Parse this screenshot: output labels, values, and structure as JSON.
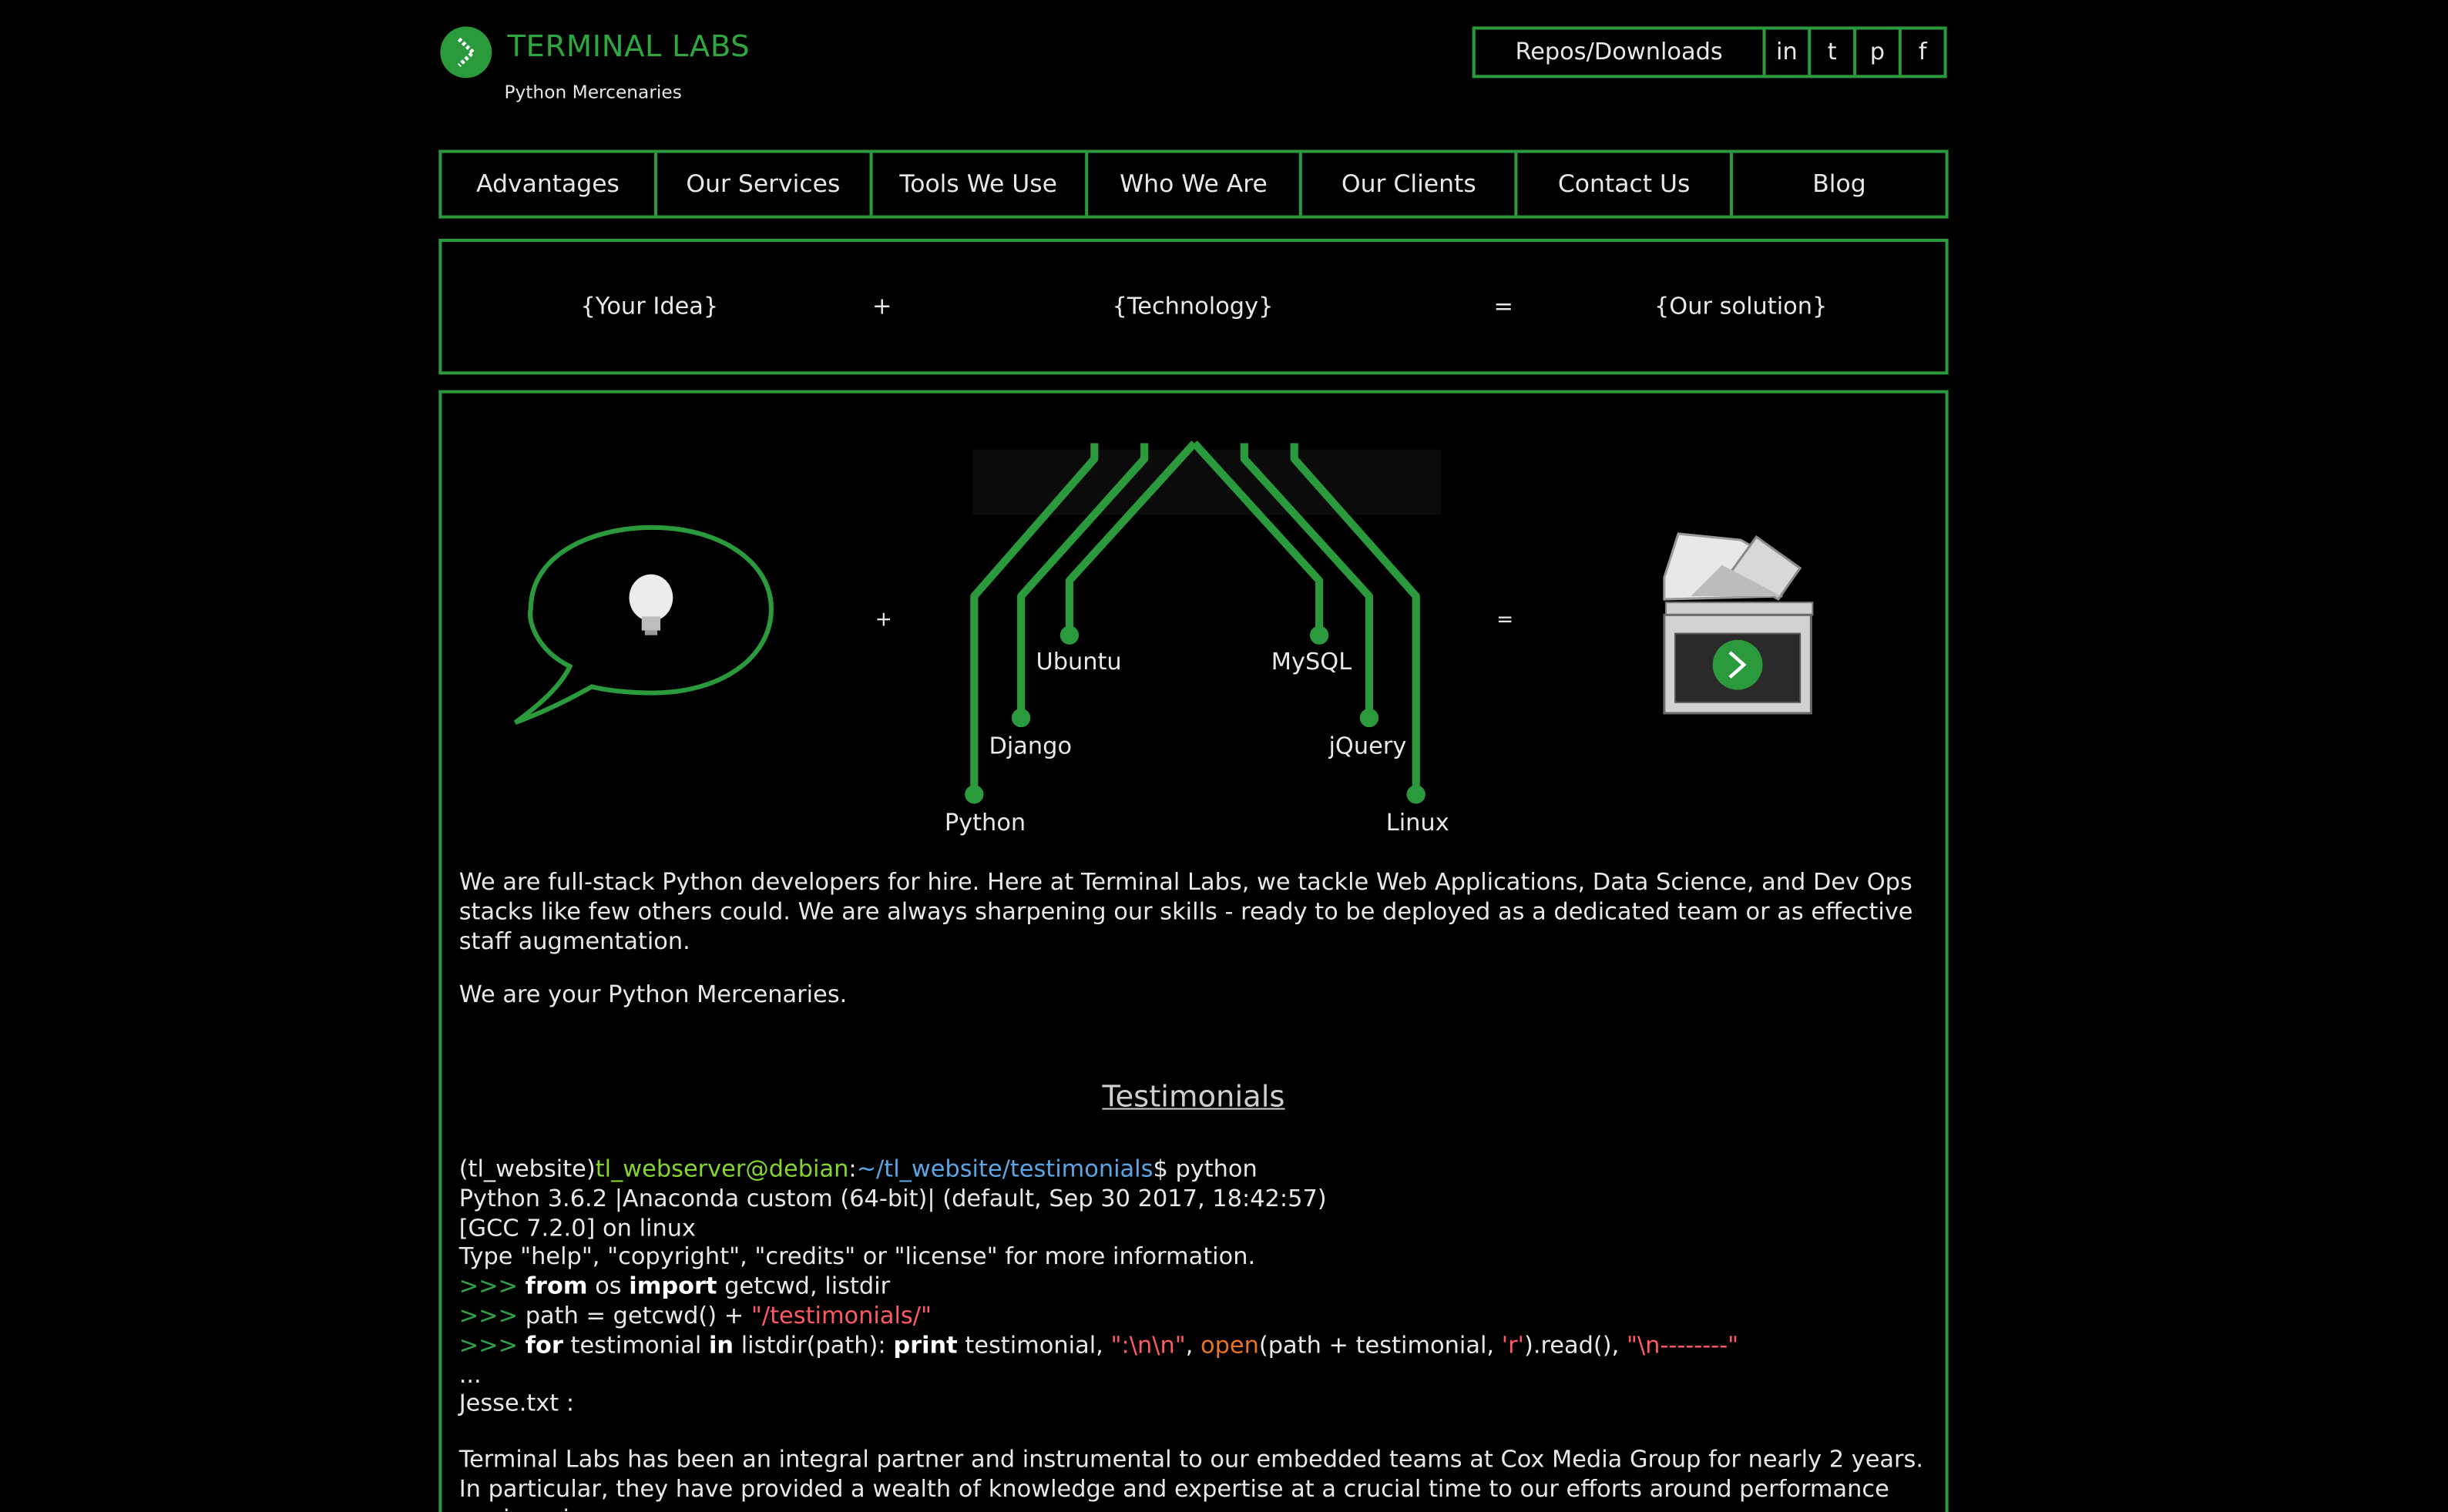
{
  "brand": {
    "name": "TERMINAL LABS",
    "tagline": "Python Mercenaries"
  },
  "header_links": {
    "repos": "Repos/Downloads",
    "linkedin": "in",
    "twitter": "t",
    "pinterest": "p",
    "facebook": "f"
  },
  "nav": {
    "items": [
      "Advantages",
      "Our Services",
      "Tools We Use",
      "Who We Are",
      "Our Clients",
      "Contact Us",
      "Blog"
    ]
  },
  "equation": {
    "idea": "{Your Idea}",
    "plus": "+",
    "technology": "{Technology}",
    "equals": "=",
    "solution": "{Our solution}"
  },
  "illustration": {
    "plus": "+",
    "equals": "=",
    "technologies": [
      "Ubuntu",
      "MySQL",
      "Django",
      "jQuery",
      "Python",
      "Linux"
    ]
  },
  "intro": {
    "paragraph": "We are full-stack Python developers for hire. Here at Terminal Labs, we tackle Web Applications, Data Science, and Dev Ops stacks like few others could. We are always sharpening our skills - ready to be deployed as a dedicated team or as effective staff augmentation.",
    "tagline": "We are your Python Mercenaries."
  },
  "testimonials": {
    "title": "Testimonials",
    "prompt_env": "(tl_website)",
    "prompt_user": "tl_webserver@debian",
    "prompt_sep": ":",
    "prompt_path": "~/tl_website/testimonials",
    "prompt_cmd": "$ python",
    "line_version": "Python 3.6.2 |Anaconda custom (64-bit)| (default, Sep 30 2017, 18:42:57)",
    "line_gcc": "[GCC 7.2.0] on linux",
    "line_help": "Type \"help\", \"copyright\", \"credits\" or \"license\" for more information.",
    "repl_prompt": ">>> ",
    "code1_from": "from",
    "code1_mod": " os ",
    "code1_import": "import",
    "code1_rest": " getcwd, listdir",
    "code2_a": "path = getcwd() + ",
    "code2_str": "\"/testimonials/\"",
    "code3_for": "for",
    "code3_b": " testimonial ",
    "code3_in": "in",
    "code3_c": " listdir(path): ",
    "code3_print": "print",
    "code3_d": " testimonial, ",
    "code3_str1": "\":\\n\\n\"",
    "code3_e": ", ",
    "code3_open": "open",
    "code3_f": "(path + testimonial, ",
    "code3_str2": "'r'",
    "code3_g": ").read(), ",
    "code3_str3": "\"\\n--------\"",
    "ellipsis": "...",
    "file": "Jesse.txt :",
    "quote": "Terminal Labs has been an integral partner and instrumental to our embedded teams at Cox Media Group for nearly 2 years. In particular, they have provided a wealth of knowledge and expertise at a crucial time to our efforts around performance engineering"
  }
}
